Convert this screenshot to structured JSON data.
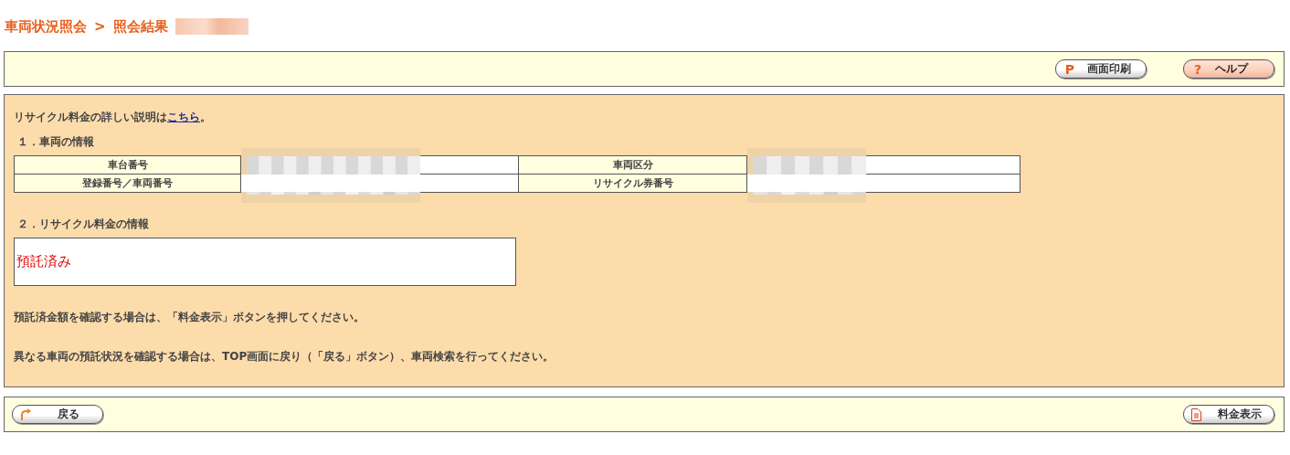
{
  "breadcrumb": {
    "items": [
      {
        "label": "車両状況照会"
      },
      {
        "label": "照会結果"
      }
    ],
    "separator": ">"
  },
  "toolbar": {
    "buttons": [
      {
        "kind": "print",
        "icon": "P",
        "label": "画面印刷"
      },
      {
        "kind": "help",
        "icon": "?",
        "label": "ヘルプ"
      }
    ]
  },
  "intro": {
    "text": "リサイクル料金の詳しい説明は",
    "link": "こちら",
    "suffix": "。"
  },
  "vehicle_section": {
    "heading": "１．車両の情報",
    "rows": [
      {
        "label_1": "車台番号",
        "label_2": "車両区分"
      },
      {
        "label_1": "登録番号／車両番号",
        "label_2": "リサイクル券番号"
      }
    ]
  },
  "fee_section": {
    "heading": "２．リサイクル料金の情報",
    "status": "預託済み"
  },
  "notes": [
    "預託済金額を確認する場合は、「料金表示」ボタンを押してください。",
    "異なる車両の預託状況を確認する場合は、TOP画面に戻り（「戻る」ボタン）、車両検索を行ってください。"
  ],
  "footer": {
    "buttons": [
      {
        "kind": "back",
        "label": "戻る"
      },
      {
        "kind": "fee",
        "label": "料金表示"
      }
    ]
  }
}
